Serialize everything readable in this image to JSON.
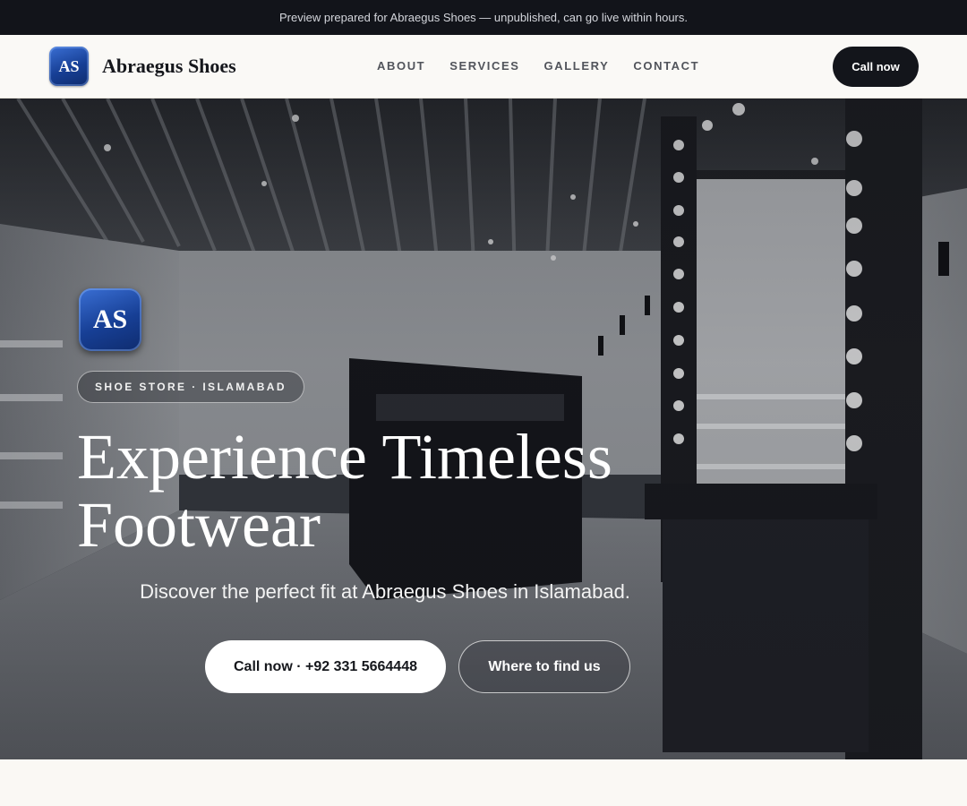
{
  "preview_banner": {
    "text": "Preview prepared for Abraegus Shoes — unpublished, can go live within hours."
  },
  "header": {
    "logo_initials": "AS",
    "brand_name": "Abraegus Shoes",
    "nav": [
      {
        "label": "ABOUT"
      },
      {
        "label": "SERVICES"
      },
      {
        "label": "GALLERY"
      },
      {
        "label": "CONTACT"
      }
    ],
    "cta_label": "Call now"
  },
  "hero": {
    "badge_initials": "AS",
    "eyebrow": "SHOE STORE · ISLAMABAD",
    "title_line1": "Experience Timeless",
    "title_line2": "Footwear",
    "subtitle": "Discover the perfect fit at Abraegus Shoes in Islamabad.",
    "primary_button": "Call now · +92 331 5664448",
    "secondary_button": "Where to find us",
    "background_image": "store-interior-photo"
  },
  "colors": {
    "topbar_bg": "#12141a",
    "header_bg": "#faf9f6",
    "dark_button": "#13151b",
    "logo_blue": "#173f95",
    "page_bg": "#faf8f4"
  }
}
